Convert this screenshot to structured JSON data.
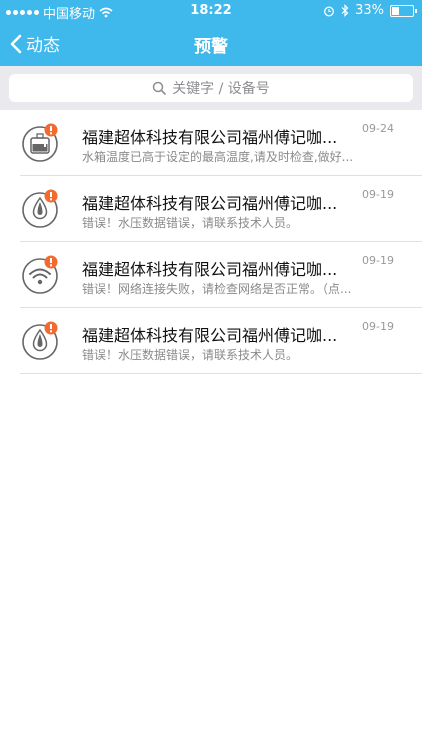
{
  "status_bar": {
    "carrier": "中国移动",
    "time": "18:22",
    "battery": "33%",
    "battery_level": 0.33
  },
  "nav": {
    "back_label": "动态",
    "title": "预警"
  },
  "search": {
    "placeholder": "关键字 / 设备号"
  },
  "alerts": [
    {
      "icon": "water-tank-alert-icon",
      "title": "福建超体科技有限公司福州傅记咖...",
      "message": "水箱温度已高于设定的最高温度,请及时检查,做好...",
      "date": "09-24"
    },
    {
      "icon": "water-drop-alert-icon",
      "title": "福建超体科技有限公司福州傅记咖...",
      "message": "错误！水压数据错误，请联系技术人员。",
      "date": "09-19"
    },
    {
      "icon": "wifi-alert-icon",
      "title": "福建超体科技有限公司福州傅记咖...",
      "message": "错误！网络连接失败，请检查网络是否正常。（点...",
      "date": "09-19"
    },
    {
      "icon": "water-drop-alert-icon",
      "title": "福建超体科技有限公司福州傅记咖...",
      "message": "错误！水压数据错误，请联系技术人员。",
      "date": "09-19"
    }
  ],
  "colors": {
    "accent": "#3fb8ec",
    "alert_badge": "#f26a2e"
  }
}
